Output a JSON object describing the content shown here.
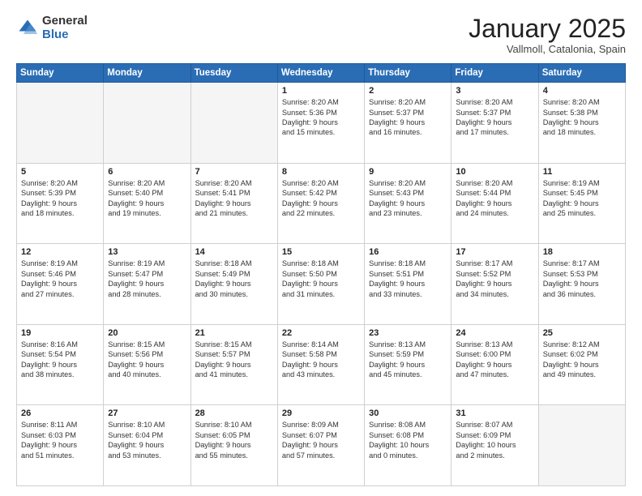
{
  "logo": {
    "general": "General",
    "blue": "Blue"
  },
  "header": {
    "month": "January 2025",
    "location": "Vallmoll, Catalonia, Spain"
  },
  "weekdays": [
    "Sunday",
    "Monday",
    "Tuesday",
    "Wednesday",
    "Thursday",
    "Friday",
    "Saturday"
  ],
  "weeks": [
    [
      {
        "day": "",
        "text": ""
      },
      {
        "day": "",
        "text": ""
      },
      {
        "day": "",
        "text": ""
      },
      {
        "day": "1",
        "text": "Sunrise: 8:20 AM\nSunset: 5:36 PM\nDaylight: 9 hours\nand 15 minutes."
      },
      {
        "day": "2",
        "text": "Sunrise: 8:20 AM\nSunset: 5:37 PM\nDaylight: 9 hours\nand 16 minutes."
      },
      {
        "day": "3",
        "text": "Sunrise: 8:20 AM\nSunset: 5:37 PM\nDaylight: 9 hours\nand 17 minutes."
      },
      {
        "day": "4",
        "text": "Sunrise: 8:20 AM\nSunset: 5:38 PM\nDaylight: 9 hours\nand 18 minutes."
      }
    ],
    [
      {
        "day": "5",
        "text": "Sunrise: 8:20 AM\nSunset: 5:39 PM\nDaylight: 9 hours\nand 18 minutes."
      },
      {
        "day": "6",
        "text": "Sunrise: 8:20 AM\nSunset: 5:40 PM\nDaylight: 9 hours\nand 19 minutes."
      },
      {
        "day": "7",
        "text": "Sunrise: 8:20 AM\nSunset: 5:41 PM\nDaylight: 9 hours\nand 21 minutes."
      },
      {
        "day": "8",
        "text": "Sunrise: 8:20 AM\nSunset: 5:42 PM\nDaylight: 9 hours\nand 22 minutes."
      },
      {
        "day": "9",
        "text": "Sunrise: 8:20 AM\nSunset: 5:43 PM\nDaylight: 9 hours\nand 23 minutes."
      },
      {
        "day": "10",
        "text": "Sunrise: 8:20 AM\nSunset: 5:44 PM\nDaylight: 9 hours\nand 24 minutes."
      },
      {
        "day": "11",
        "text": "Sunrise: 8:19 AM\nSunset: 5:45 PM\nDaylight: 9 hours\nand 25 minutes."
      }
    ],
    [
      {
        "day": "12",
        "text": "Sunrise: 8:19 AM\nSunset: 5:46 PM\nDaylight: 9 hours\nand 27 minutes."
      },
      {
        "day": "13",
        "text": "Sunrise: 8:19 AM\nSunset: 5:47 PM\nDaylight: 9 hours\nand 28 minutes."
      },
      {
        "day": "14",
        "text": "Sunrise: 8:18 AM\nSunset: 5:49 PM\nDaylight: 9 hours\nand 30 minutes."
      },
      {
        "day": "15",
        "text": "Sunrise: 8:18 AM\nSunset: 5:50 PM\nDaylight: 9 hours\nand 31 minutes."
      },
      {
        "day": "16",
        "text": "Sunrise: 8:18 AM\nSunset: 5:51 PM\nDaylight: 9 hours\nand 33 minutes."
      },
      {
        "day": "17",
        "text": "Sunrise: 8:17 AM\nSunset: 5:52 PM\nDaylight: 9 hours\nand 34 minutes."
      },
      {
        "day": "18",
        "text": "Sunrise: 8:17 AM\nSunset: 5:53 PM\nDaylight: 9 hours\nand 36 minutes."
      }
    ],
    [
      {
        "day": "19",
        "text": "Sunrise: 8:16 AM\nSunset: 5:54 PM\nDaylight: 9 hours\nand 38 minutes."
      },
      {
        "day": "20",
        "text": "Sunrise: 8:15 AM\nSunset: 5:56 PM\nDaylight: 9 hours\nand 40 minutes."
      },
      {
        "day": "21",
        "text": "Sunrise: 8:15 AM\nSunset: 5:57 PM\nDaylight: 9 hours\nand 41 minutes."
      },
      {
        "day": "22",
        "text": "Sunrise: 8:14 AM\nSunset: 5:58 PM\nDaylight: 9 hours\nand 43 minutes."
      },
      {
        "day": "23",
        "text": "Sunrise: 8:13 AM\nSunset: 5:59 PM\nDaylight: 9 hours\nand 45 minutes."
      },
      {
        "day": "24",
        "text": "Sunrise: 8:13 AM\nSunset: 6:00 PM\nDaylight: 9 hours\nand 47 minutes."
      },
      {
        "day": "25",
        "text": "Sunrise: 8:12 AM\nSunset: 6:02 PM\nDaylight: 9 hours\nand 49 minutes."
      }
    ],
    [
      {
        "day": "26",
        "text": "Sunrise: 8:11 AM\nSunset: 6:03 PM\nDaylight: 9 hours\nand 51 minutes."
      },
      {
        "day": "27",
        "text": "Sunrise: 8:10 AM\nSunset: 6:04 PM\nDaylight: 9 hours\nand 53 minutes."
      },
      {
        "day": "28",
        "text": "Sunrise: 8:10 AM\nSunset: 6:05 PM\nDaylight: 9 hours\nand 55 minutes."
      },
      {
        "day": "29",
        "text": "Sunrise: 8:09 AM\nSunset: 6:07 PM\nDaylight: 9 hours\nand 57 minutes."
      },
      {
        "day": "30",
        "text": "Sunrise: 8:08 AM\nSunset: 6:08 PM\nDaylight: 10 hours\nand 0 minutes."
      },
      {
        "day": "31",
        "text": "Sunrise: 8:07 AM\nSunset: 6:09 PM\nDaylight: 10 hours\nand 2 minutes."
      },
      {
        "day": "",
        "text": ""
      }
    ]
  ]
}
